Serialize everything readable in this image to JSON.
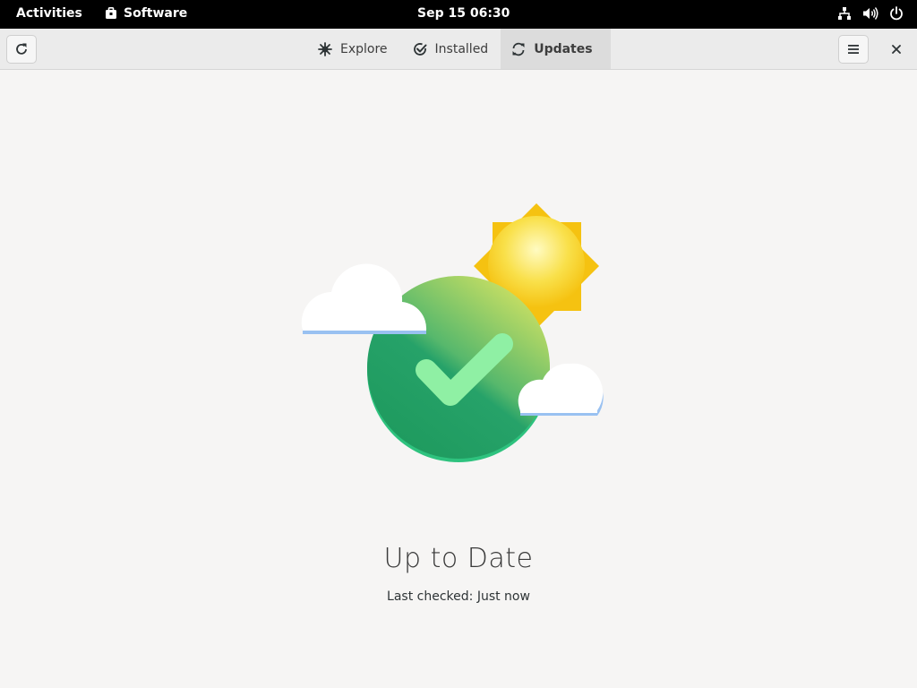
{
  "topbar": {
    "activities": "Activities",
    "app_name": "Software",
    "clock": "Sep 15  06:30"
  },
  "header": {
    "tabs": [
      {
        "label": "Explore",
        "icon": "explore-icon"
      },
      {
        "label": "Installed",
        "icon": "installed-check-icon"
      },
      {
        "label": "Updates",
        "icon": "updates-icon",
        "active": true
      }
    ]
  },
  "main": {
    "title": "Up to Date",
    "subtitle": "Last checked: Just now"
  },
  "colors": {
    "topbar": "#000000",
    "headerbar": "#ebebeb",
    "active_tab": "#dcdcdc",
    "background": "#f6f5f4",
    "check_green": "#26a269",
    "sun_yellow": "#f5c211"
  }
}
